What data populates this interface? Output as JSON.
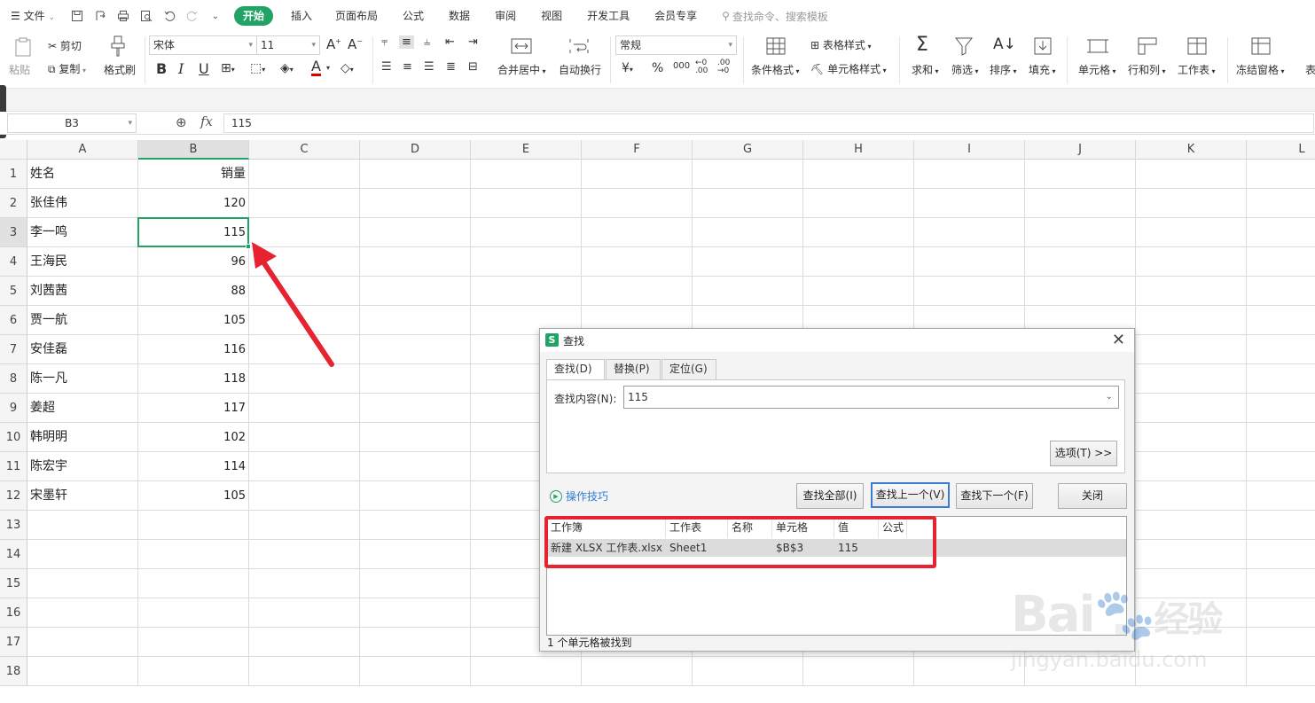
{
  "menu": {
    "file": "文件",
    "tabs": [
      "开始",
      "插入",
      "页面布局",
      "公式",
      "数据",
      "审阅",
      "视图",
      "开发工具",
      "会员专享"
    ],
    "active_tab": "开始",
    "search_placeholder": "查找命令、搜索模板"
  },
  "ribbon": {
    "paste": "粘贴",
    "cut": "剪切",
    "copy": "复制",
    "format_painter": "格式刷",
    "font_name": "宋体",
    "font_size": "11",
    "merge_center": "合并居中",
    "wrap_text": "自动换行",
    "number_format": "常规",
    "conditional_format": "条件格式",
    "table_style": "表格样式",
    "cell_style": "单元格样式",
    "sum": "求和",
    "filter": "筛选",
    "sort": "排序",
    "fill": "填充",
    "cell": "单元格",
    "row_col": "行和列",
    "worksheet": "工作表",
    "freeze": "冻结窗格",
    "more": "表"
  },
  "formula_bar": {
    "cell_ref": "B3",
    "fx": "fx",
    "value": "115"
  },
  "sheet": {
    "columns": [
      "A",
      "B",
      "C",
      "D",
      "E",
      "F",
      "G",
      "H",
      "I",
      "J",
      "K",
      "L"
    ],
    "rows": [
      "1",
      "2",
      "3",
      "4",
      "5",
      "6",
      "7",
      "8",
      "9",
      "10",
      "11",
      "12",
      "13",
      "14",
      "15",
      "16",
      "17",
      "18"
    ],
    "header_name": "姓名",
    "header_sales": "销量",
    "data": [
      {
        "name": "张佳伟",
        "sales": "120"
      },
      {
        "name": "李一鸣",
        "sales": "115"
      },
      {
        "name": "王海民",
        "sales": "96"
      },
      {
        "name": "刘茜茜",
        "sales": "88"
      },
      {
        "name": "贾一航",
        "sales": "105"
      },
      {
        "name": "安佳磊",
        "sales": "116"
      },
      {
        "name": "陈一凡",
        "sales": "118"
      },
      {
        "name": "姜超",
        "sales": "117"
      },
      {
        "name": "韩明明",
        "sales": "102"
      },
      {
        "name": "陈宏宇",
        "sales": "114"
      },
      {
        "name": "宋墨轩",
        "sales": "105"
      }
    ]
  },
  "dialog": {
    "logo": "S",
    "title": "查找",
    "close": "✕",
    "tabs": [
      "查找(D)",
      "替换(P)",
      "定位(G)"
    ],
    "find_label": "查找内容(N):",
    "find_value": "115",
    "options_button": "选项(T) >>",
    "tips": "操作技巧",
    "find_all": "查找全部(I)",
    "find_prev": "查找上一个(V)",
    "find_next": "查找下一个(F)",
    "close_button": "关闭",
    "result_headers": [
      "工作簿",
      "工作表",
      "名称",
      "单元格",
      "值",
      "公式"
    ],
    "result": {
      "workbook": "新建 XLSX 工作表.xlsx",
      "sheet": "Sheet1",
      "name": "",
      "cell": "$B$3",
      "value": "115",
      "formula": ""
    },
    "status": "1 个单元格被找到"
  },
  "watermark": {
    "logo": "Bai",
    "logo2": "经验",
    "url": "jingyan.baidu.com"
  },
  "colors": {
    "accent_green": "#21a366",
    "highlight_red": "#e62431"
  }
}
